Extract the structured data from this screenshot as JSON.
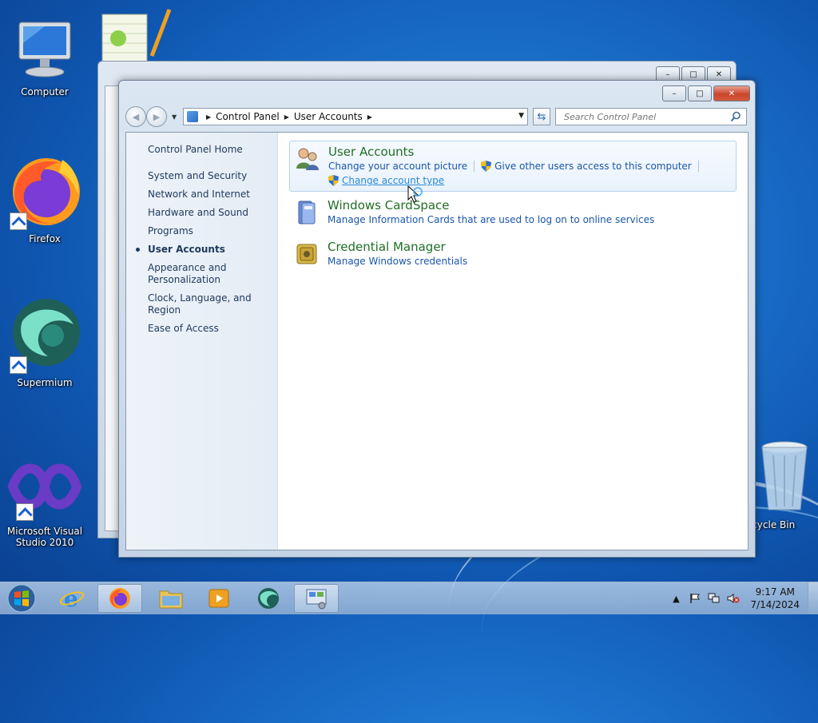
{
  "desktop": {
    "icons": [
      {
        "label": "Computer"
      },
      {
        "label": "Firefox"
      },
      {
        "label": "Supermium"
      },
      {
        "label": "Microsoft Visual Studio 2010"
      },
      {
        "label": "Recycle Bin"
      }
    ]
  },
  "window": {
    "breadcrumb": [
      "Control Panel",
      "User Accounts"
    ],
    "search_placeholder": "Search Control Panel",
    "controls": {
      "minimize": "–",
      "maximize": "□",
      "close": "✕"
    }
  },
  "left_nav": {
    "home": "Control Panel Home",
    "items": [
      {
        "label": "System and Security"
      },
      {
        "label": "Network and Internet"
      },
      {
        "label": "Hardware and Sound"
      },
      {
        "label": "Programs"
      },
      {
        "label": "User Accounts",
        "active": true
      },
      {
        "label": "Appearance and Personalization"
      },
      {
        "label": "Clock, Language, and Region"
      },
      {
        "label": "Ease of Access"
      }
    ]
  },
  "categories": [
    {
      "title": "User Accounts",
      "links": [
        "Change your account picture",
        "Give other users access to this computer",
        "Change account type"
      ]
    },
    {
      "title": "Windows CardSpace",
      "links": [
        "Manage Information Cards that are used to log on to online services"
      ]
    },
    {
      "title": "Credential Manager",
      "links": [
        "Manage Windows credentials"
      ]
    }
  ],
  "taskbar": {
    "clock_time": "9:17 AM",
    "clock_date": "7/14/2024"
  },
  "colors": {
    "category_title": "#1f6f25",
    "link": "#1a56a8",
    "nav_text": "#1e395b",
    "desktop_bg": "#1a6fc9"
  }
}
